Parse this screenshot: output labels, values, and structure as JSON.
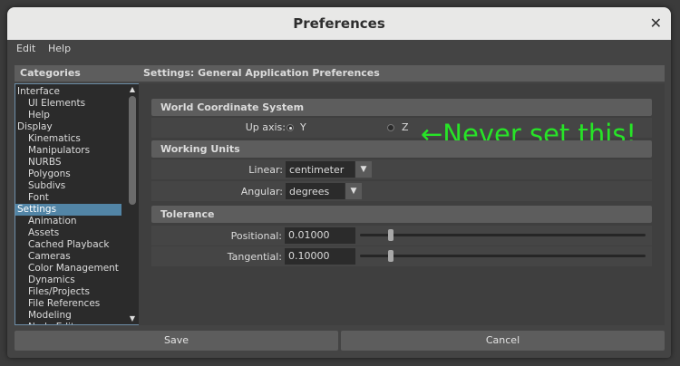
{
  "window": {
    "title": "Preferences"
  },
  "menu": {
    "items": [
      "Edit",
      "Help"
    ]
  },
  "categories": {
    "title": "Categories",
    "selected": "Settings",
    "items": [
      {
        "label": "Interface",
        "indent": 0
      },
      {
        "label": "UI Elements",
        "indent": 1
      },
      {
        "label": "Help",
        "indent": 1
      },
      {
        "label": "Display",
        "indent": 0
      },
      {
        "label": "Kinematics",
        "indent": 1
      },
      {
        "label": "Manipulators",
        "indent": 1
      },
      {
        "label": "NURBS",
        "indent": 1
      },
      {
        "label": "Polygons",
        "indent": 1
      },
      {
        "label": "Subdivs",
        "indent": 1
      },
      {
        "label": "Font",
        "indent": 1
      },
      {
        "label": "Settings",
        "indent": 0
      },
      {
        "label": "Animation",
        "indent": 1
      },
      {
        "label": "Assets",
        "indent": 1
      },
      {
        "label": "Cached Playback",
        "indent": 1
      },
      {
        "label": "Cameras",
        "indent": 1
      },
      {
        "label": "Color Management",
        "indent": 1
      },
      {
        "label": "Dynamics",
        "indent": 1
      },
      {
        "label": "Files/Projects",
        "indent": 1
      },
      {
        "label": "File References",
        "indent": 1
      },
      {
        "label": "Modeling",
        "indent": 1
      },
      {
        "label": "Node Editor",
        "indent": 1
      }
    ]
  },
  "settings": {
    "title": "Settings: General Application Preferences",
    "world": {
      "header": "World Coordinate System",
      "up_axis_label": "Up axis:",
      "option_y": "Y",
      "option_z": "Z",
      "selected": "Y",
      "annotation": "←Never set this!"
    },
    "units": {
      "header": "Working Units",
      "linear_label": "Linear:",
      "linear_value": "centimeter",
      "angular_label": "Angular:",
      "angular_value": "degrees"
    },
    "tolerance": {
      "header": "Tolerance",
      "positional_label": "Positional:",
      "positional_value": "0.01000",
      "tangential_label": "Tangential:",
      "tangential_value": "0.10000"
    }
  },
  "buttons": {
    "save": "Save",
    "cancel": "Cancel"
  },
  "colors": {
    "annotation": "#27e427",
    "selection": "#5285a6"
  }
}
